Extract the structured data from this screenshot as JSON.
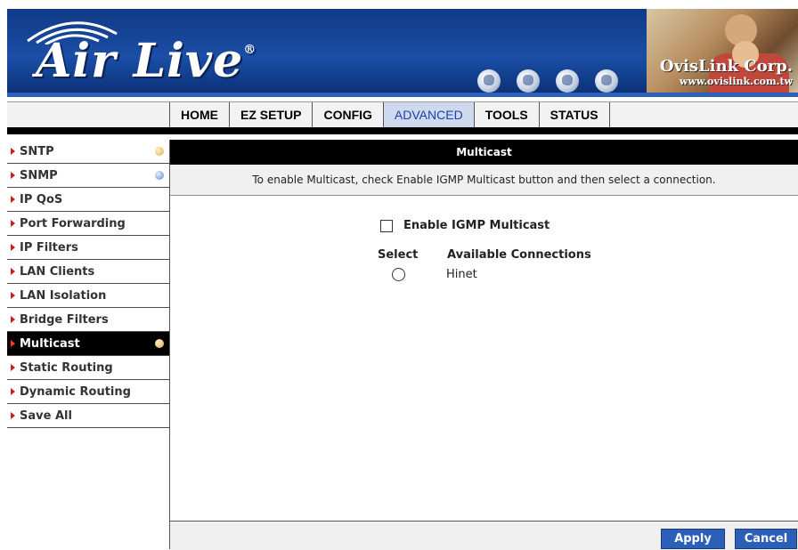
{
  "brand": {
    "logo": "Air Live",
    "registered": "®",
    "company": "OvisLink Corp.",
    "url": "www.ovislink.com.tw",
    "colors": {
      "banner": "#1b4ea6",
      "accent": "#2b5fb8",
      "active_nav": "#1f3fa8"
    }
  },
  "nav": {
    "tabs": [
      {
        "label": "HOME",
        "active": false
      },
      {
        "label": "EZ SETUP",
        "active": false
      },
      {
        "label": "CONFIG",
        "active": false
      },
      {
        "label": "ADVANCED",
        "active": true
      },
      {
        "label": "TOOLS",
        "active": false
      },
      {
        "label": "STATUS",
        "active": false
      }
    ]
  },
  "sidebar": {
    "items": [
      {
        "label": "SNTP",
        "dot": "orange-dot-icon"
      },
      {
        "label": "SNMP",
        "dot": "blue-dot-icon"
      },
      {
        "label": "IP QoS"
      },
      {
        "label": "Port Forwarding"
      },
      {
        "label": "IP Filters"
      },
      {
        "label": "LAN Clients"
      },
      {
        "label": "LAN Isolation"
      },
      {
        "label": "Bridge Filters"
      },
      {
        "label": "Multicast",
        "active": true,
        "dot": "orange-dot-icon"
      },
      {
        "label": "Static Routing"
      },
      {
        "label": "Dynamic Routing"
      },
      {
        "label": "Save All"
      }
    ]
  },
  "main": {
    "title": "Multicast",
    "description": "To enable Multicast, check Enable IGMP Multicast button and then select a connection.",
    "enable_label": "Enable IGMP Multicast",
    "enable_checked": false,
    "columns": {
      "select": "Select",
      "connections": "Available Connections"
    },
    "connections": [
      {
        "name": "Hinet",
        "selected": false
      }
    ],
    "apply_label": "Apply",
    "cancel_label": "Cancel"
  }
}
